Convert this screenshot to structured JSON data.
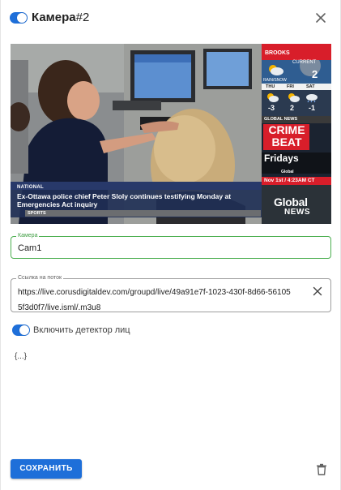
{
  "header": {
    "toggle_on": true,
    "title_bold": "Камера",
    "title_suffix": "#2"
  },
  "video": {
    "news": {
      "label": "NATIONAL",
      "headline": "Ex-Ottawa police chief Peter Sloly continues testifying Monday at Emergencies Act inquiry",
      "ticker": "SPORTS"
    },
    "weather": {
      "city": "BROOKS",
      "current_label": "CURRENT",
      "current_temp": "2",
      "condition": "RAIN/SNOW",
      "days": [
        "THU",
        "FRI",
        "SAT"
      ],
      "temps": [
        "-3",
        "2",
        "-1"
      ]
    },
    "promo": {
      "network": "GLOBAL NEWS",
      "show": "CRIME BEAT",
      "day": "Fridays",
      "brand": "Global"
    },
    "datetime": "Nov 1st / 4:23AM CT",
    "logo_line1": "Global",
    "logo_line2": "NEWS"
  },
  "form": {
    "camera": {
      "label": "Камера",
      "value": "Cam1"
    },
    "stream": {
      "label": "Ссылка на поток",
      "value": "https://live.corusdigitaldev.com/groupd/live/49a91e7f-1023-430f-8d66-561055f3d0f7/live.isml/.m3u8"
    },
    "face_detector": {
      "label": "Включить детектор лиц",
      "on": true
    },
    "json_button": "{...}"
  },
  "footer": {
    "save_label": "СОХРАНИТЬ"
  },
  "colors": {
    "accent": "#1e6fd9",
    "focus_border": "#4caf50",
    "news_red": "#d81e2a"
  }
}
